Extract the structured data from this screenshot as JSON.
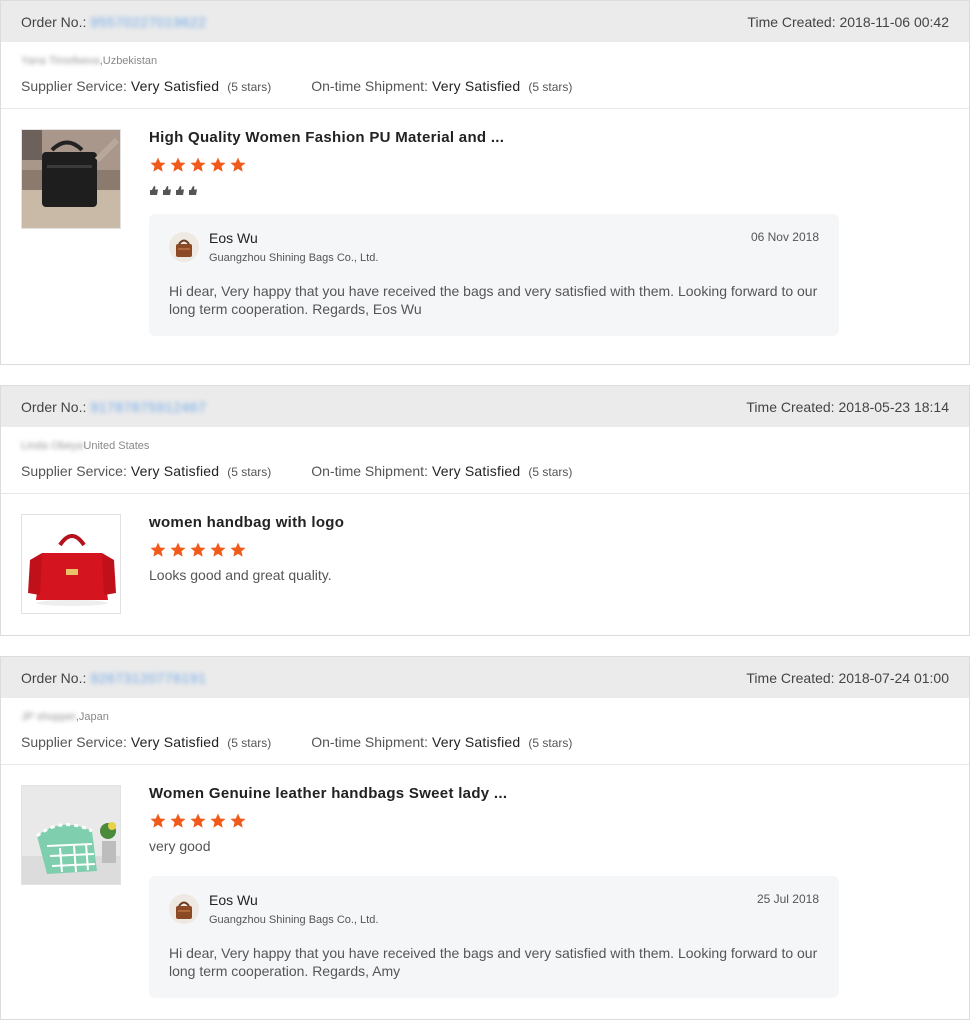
{
  "orders": [
    {
      "order_no_label": "Order No.:",
      "order_no_value": "95570227019622",
      "time_created": "Time Created: 2018-11-06 00:42",
      "buyer_name": "Yana Timofeeva",
      "buyer_country": ",Uzbekistan",
      "supplier_service_label": "Supplier Service:",
      "supplier_service_value": "Very Satisfied",
      "supplier_service_stars": "(5 stars)",
      "shipment_label": "On-time Shipment:",
      "shipment_value": "Very Satisfied",
      "shipment_stars": "(5 stars)",
      "product_title": "High Quality Women Fashion PU Material and ...",
      "product_rating": 5,
      "feedback_text": "",
      "reply": {
        "name": "Eos Wu",
        "company": "Guangzhou Shining Bags Co., Ltd.",
        "date": "06 Nov 2018",
        "text": "Hi dear, Very happy that you have received the bags and very satisfied with them. Looking forward to our long term cooperation. Regards, Eos Wu"
      }
    },
    {
      "order_no_label": "Order No.:",
      "order_no_value": "91787875912467",
      "time_created": "Time Created: 2018-05-23 18:14",
      "buyer_name": "Linda Obeya",
      "buyer_country": "United States",
      "supplier_service_label": "Supplier Service:",
      "supplier_service_value": "Very Satisfied",
      "supplier_service_stars": "(5 stars)",
      "shipment_label": "On-time Shipment:",
      "shipment_value": "Very Satisfied",
      "shipment_stars": "(5 stars)",
      "product_title": "women handbag with logo",
      "product_rating": 5,
      "feedback_text": "Looks good and great quality."
    },
    {
      "order_no_label": "Order No.:",
      "order_no_value": "92673120776191",
      "time_created": "Time Created: 2018-07-24 01:00",
      "buyer_name": "JP shopper",
      "buyer_country": ",Japan",
      "supplier_service_label": "Supplier Service:",
      "supplier_service_value": "Very Satisfied",
      "supplier_service_stars": "(5 stars)",
      "shipment_label": "On-time Shipment:",
      "shipment_value": "Very Satisfied",
      "shipment_stars": "(5 stars)",
      "product_title": "Women Genuine leather handbags Sweet lady ...",
      "product_rating": 5,
      "feedback_text": "very good",
      "reply": {
        "name": "Eos Wu",
        "company": "Guangzhou Shining Bags Co., Ltd.",
        "date": "25 Jul 2018",
        "text": "Hi dear, Very happy that you have received the bags and very satisfied with them. Looking forward to our long term cooperation. Regards, Amy"
      }
    }
  ],
  "colors": {
    "star": "#f05a1a",
    "header_bg": "#ebebeb",
    "reply_bg": "#f5f6f8",
    "order_link": "#6fa7e6"
  },
  "icons": {
    "rating": "star-icon",
    "thumbs": "thumbs-up-icon"
  }
}
